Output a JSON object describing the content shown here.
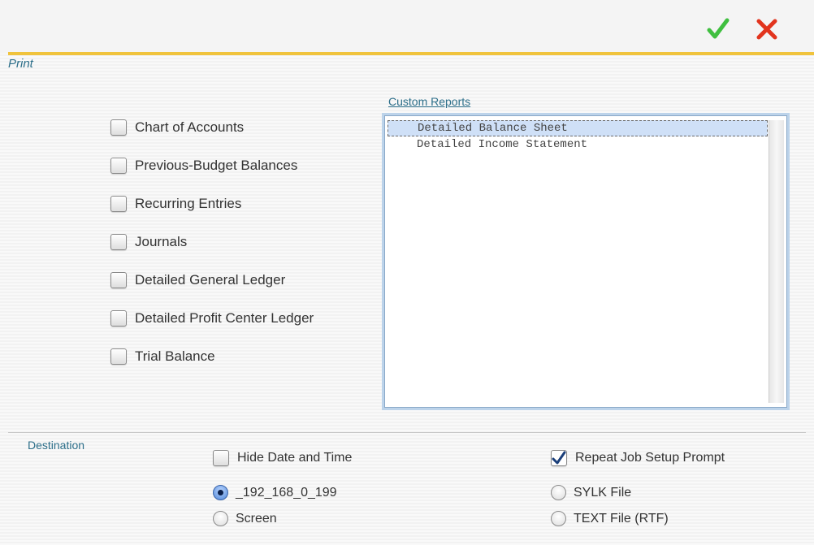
{
  "header": {
    "ok_icon": "checkmark-icon",
    "ok_color": "#3fbf3f",
    "cancel_icon": "close-x-icon",
    "cancel_color": "#e2341d",
    "rule_color": "#f0c33c"
  },
  "print": {
    "title": "Print",
    "reports": [
      {
        "label": "Chart of Accounts",
        "checked": false
      },
      {
        "label": "Previous-Budget Balances",
        "checked": false
      },
      {
        "label": "Recurring Entries",
        "checked": false
      },
      {
        "label": "Journals",
        "checked": false
      },
      {
        "label": "Detailed General Ledger",
        "checked": false
      },
      {
        "label": "Detailed Profit Center Ledger",
        "checked": false
      },
      {
        "label": "Trial Balance",
        "checked": false
      }
    ]
  },
  "custom_reports": {
    "label": "Custom Reports",
    "items": [
      {
        "label": "Detailed Balance Sheet",
        "selected": true
      },
      {
        "label": "Detailed Income Statement",
        "selected": false
      }
    ]
  },
  "destination": {
    "label": "Destination",
    "hide_date_time": {
      "label": "Hide Date and Time",
      "checked": false
    },
    "repeat_job_setup": {
      "label": "Repeat Job Setup Prompt",
      "checked": true
    },
    "outputs": [
      {
        "label": "_192_168_0_199",
        "selected": true
      },
      {
        "label": "Screen",
        "selected": false
      },
      {
        "label": "SYLK File",
        "selected": false
      },
      {
        "label": "TEXT File (RTF)",
        "selected": false
      }
    ]
  }
}
